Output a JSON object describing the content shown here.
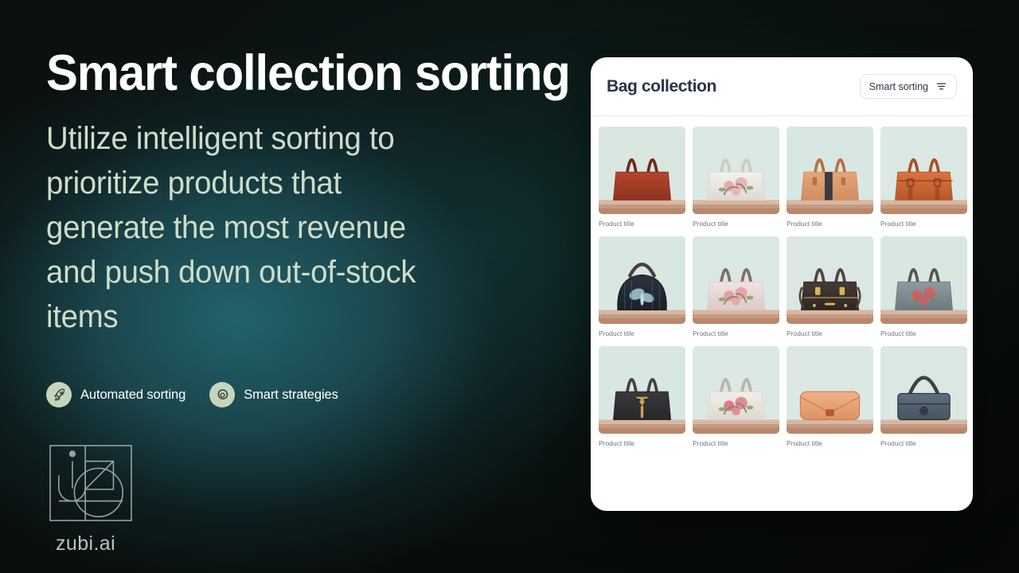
{
  "background": {
    "base_color": "#0a0d0c",
    "glow_color": "#246670"
  },
  "hero": {
    "headline": "Smart collection sorting",
    "subhead": "Utilize intelligent sorting to prioritize products that generate the most revenue and push down out-of-stock items",
    "headline_color": "#ffffff",
    "subhead_color": "#cfdcc9",
    "badges": [
      {
        "label": "Automated sorting",
        "icon": "rocket-icon",
        "bg": "#c6d4bd"
      },
      {
        "label": "Smart strategies",
        "icon": "gear-icon",
        "bg": "#c6d4bd"
      }
    ]
  },
  "logo": {
    "wordmark": "zubi.ai",
    "mark": "zubi-monogram-icon",
    "color": "#b9c3c2"
  },
  "card": {
    "title": "Bag collection",
    "title_color": "#2b3446",
    "sort_button": {
      "label": "Smart sorting",
      "icon": "filter-sort-icon"
    },
    "products": [
      {
        "title": "Product title",
        "name": "rust-tote-bag",
        "body": "#b4462c",
        "body2": "#8e3220",
        "handle": "#6e2b1c",
        "bg": "#d9e7e0",
        "accent": "#c9583a",
        "pattern": "none"
      },
      {
        "title": "Product title",
        "name": "white-floral-bag",
        "body": "#f4f2ee",
        "body2": "#ddd9d2",
        "handle": "#cfcac2",
        "bg": "#dbe8e4",
        "accent": "#e9a6ad",
        "pattern": "floral-pink"
      },
      {
        "title": "Product title",
        "name": "tan-striped-bag",
        "body": "#e2a77a",
        "body2": "#cf8f63",
        "handle": "#b9703f",
        "bg": "#d8e7e3",
        "accent": "#3c3a42",
        "pattern": "stripe-dark"
      },
      {
        "title": "Product title",
        "name": "orange-buckle-satchel",
        "body": "#d9743f",
        "body2": "#b6572a",
        "handle": "#a85227",
        "bg": "#dbe8e3",
        "accent": "#8d3f1d",
        "pattern": "buckles"
      },
      {
        "title": "Product title",
        "name": "navy-butterfly-bag",
        "body": "#2c3340",
        "body2": "#1b2029",
        "handle": "#4a4038",
        "bg": "#d9e7e2",
        "accent": "#9fc4cf",
        "pattern": "butterfly"
      },
      {
        "title": "Product title",
        "name": "pink-floral-satchel",
        "body": "#efe3e0",
        "body2": "#ddcbc7",
        "handle": "#7e6e6a",
        "bg": "#dae8e4",
        "accent": "#e69aa2",
        "pattern": "floral-pink"
      },
      {
        "title": "Product title",
        "name": "dark-brown-satchel",
        "body": "#453a36",
        "body2": "#2f2724",
        "handle": "#50433d",
        "bg": "#dae7e2",
        "accent": "#c9a martial",
        "pattern": "gold-hardware"
      },
      {
        "title": "Product title",
        "name": "grey-rose-bag",
        "body": "#8e9aa0",
        "body2": "#6e7a80",
        "handle": "#5a5450",
        "bg": "#d9e7e3",
        "accent": "#e0565e",
        "pattern": "roses"
      },
      {
        "title": "Product title",
        "name": "charcoal-gold-bag",
        "body": "#3a3a3c",
        "body2": "#262628",
        "handle": "#45413f",
        "bg": "#d9e7e2",
        "accent": "#d2a04e",
        "pattern": "gold-clasp"
      },
      {
        "title": "Product title",
        "name": "cream-rose-bag",
        "body": "#f1efe9",
        "body2": "#ded9d0",
        "handle": "#b9b5ad",
        "bg": "#dbe8e4",
        "accent": "#e0737f",
        "pattern": "roses"
      },
      {
        "title": "Product title",
        "name": "peach-envelope-clutch",
        "body": "#f0b188",
        "body2": "#dc9365",
        "handle": "#c97f52",
        "bg": "#dbe8e3",
        "accent": "#b45a38",
        "pattern": "etched"
      },
      {
        "title": "Product title",
        "name": "slate-blue-handbag",
        "body": "#5d6e7e",
        "body2": "#46545f",
        "handle": "#3b4148",
        "bg": "#dae7e3",
        "accent": "#2b3036",
        "pattern": "clasp"
      }
    ]
  }
}
